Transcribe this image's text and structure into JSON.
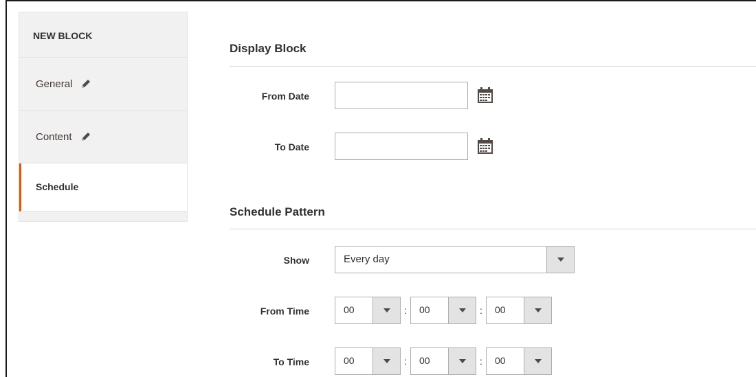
{
  "sidebar": {
    "title": "NEW BLOCK",
    "items": [
      {
        "label": "General",
        "icon": "pencil-icon",
        "active": false
      },
      {
        "label": "Content",
        "icon": "pencil-icon",
        "active": false
      },
      {
        "label": "Schedule",
        "active": true
      }
    ]
  },
  "display_block": {
    "title": "Display Block",
    "from_date": {
      "label": "From Date",
      "value": ""
    },
    "to_date": {
      "label": "To Date",
      "value": ""
    }
  },
  "schedule_pattern": {
    "title": "Schedule Pattern",
    "show": {
      "label": "Show",
      "value": "Every day"
    },
    "from_time": {
      "label": "From Time",
      "hour": "00",
      "minute": "00",
      "second": "00"
    },
    "to_time": {
      "label": "To Time",
      "hour": "00",
      "minute": "00",
      "second": "00"
    },
    "separator": ":"
  },
  "colors": {
    "accent": "#eb5202",
    "icon": "#514943"
  }
}
